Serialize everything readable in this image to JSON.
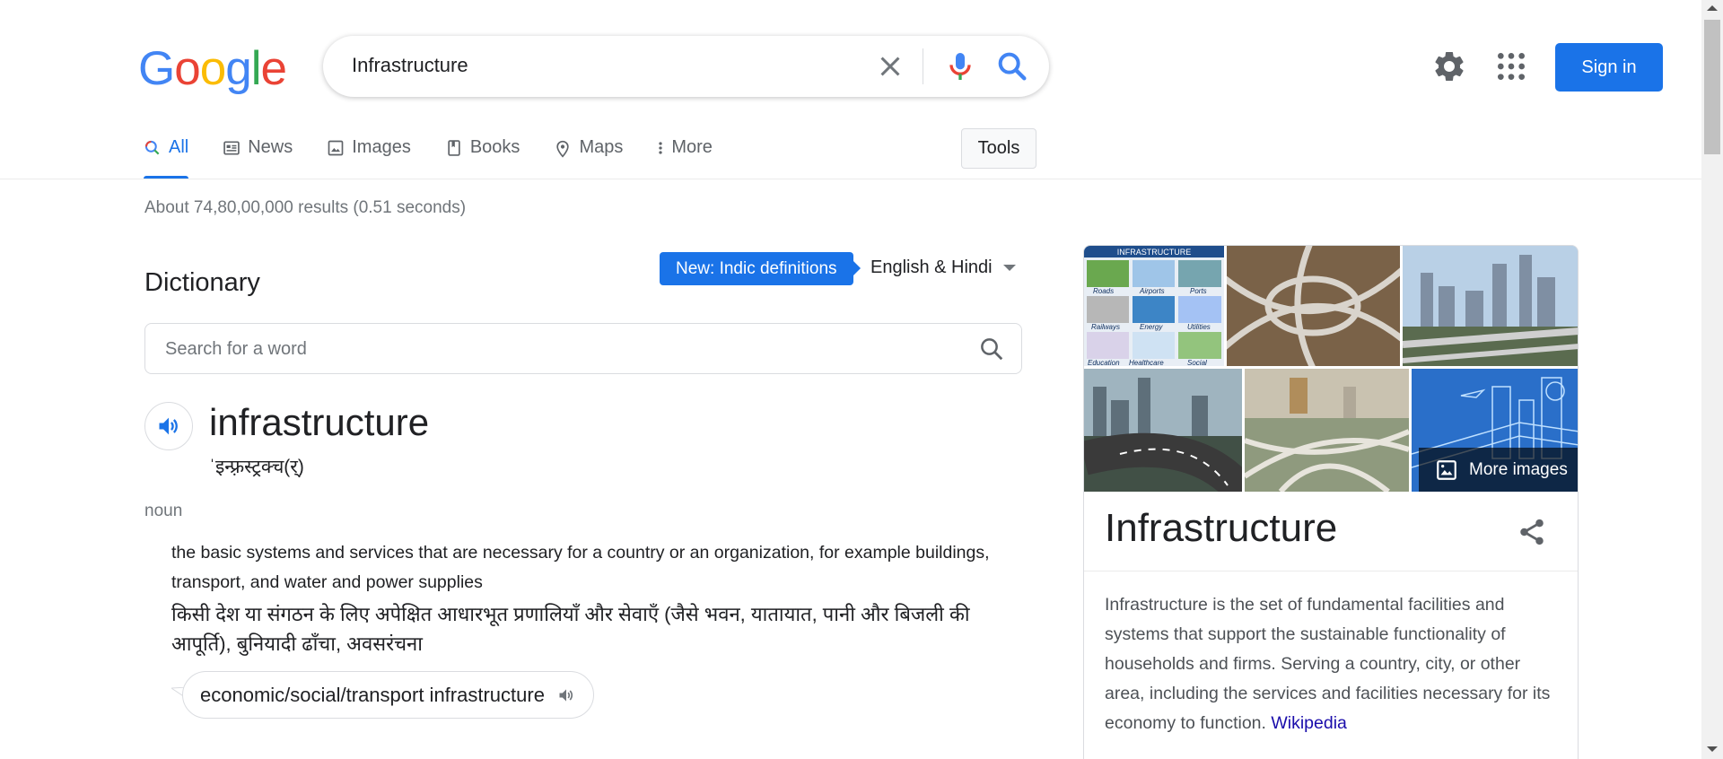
{
  "logo": {
    "letters": [
      "G",
      "o",
      "o",
      "g",
      "l",
      "e"
    ],
    "colors": [
      "#4285f4",
      "#ea4335",
      "#fbbc05",
      "#4285f4",
      "#34a853",
      "#ea4335"
    ]
  },
  "search": {
    "query": "Infrastructure",
    "clear_icon": "close-icon",
    "mic_icon": "mic-icon",
    "search_icon": "search-icon"
  },
  "header": {
    "settings_icon": "gear-icon",
    "apps_icon": "apps-grid-icon",
    "sign_in_label": "Sign in"
  },
  "tabs": [
    {
      "label": "All",
      "icon": "search-icon",
      "active": true
    },
    {
      "label": "News",
      "icon": "news-icon"
    },
    {
      "label": "Images",
      "icon": "image-icon"
    },
    {
      "label": "Books",
      "icon": "book-icon"
    },
    {
      "label": "Maps",
      "icon": "map-pin-icon"
    },
    {
      "label": "More",
      "icon": "more-vert-icon"
    }
  ],
  "tools_label": "Tools",
  "result_stats": "About 74,80,00,000 results (0.51 seconds)",
  "dictionary": {
    "title": "Dictionary",
    "new_badge": "New: Indic definitions",
    "language": "English & Hindi",
    "search_placeholder": "Search for a word",
    "word": "infrastructure",
    "pronunciation": "ˈइन्फ़्रस्ट्रक्च(र्)",
    "part_of_speech": "noun",
    "definition_en": "the basic systems and services that are necessary for a country or an organization, for example buildings, transport, and water and power supplies",
    "definition_hi": "किसी देश या संगठन के लिए अपेक्षित आधारभूत प्रणालियाँ और सेवाएँ (जैसे भवन, यातायात, पानी और बिजली की आपूर्ति), बुनियादी ढाँचा, अवसरंचना",
    "example": "economic/social/transport infrastructure"
  },
  "knowledge_panel": {
    "title": "Infrastructure",
    "more_images": "More images",
    "thumb_caption": "INFRASTRUCTURE",
    "thumb_labels": [
      "Roads",
      "Airports",
      "Ports",
      "Railways",
      "Energy",
      "Utilities",
      "Education",
      "Healthcare",
      "Social"
    ],
    "description": "Infrastructure is the set of fundamental facilities and systems that support the sustainable functionality of households and firms. Serving a country, city, or other area, including the services and facilities necessary for its economy to function.",
    "source_link": "Wikipedia",
    "share_icon": "share-icon"
  }
}
